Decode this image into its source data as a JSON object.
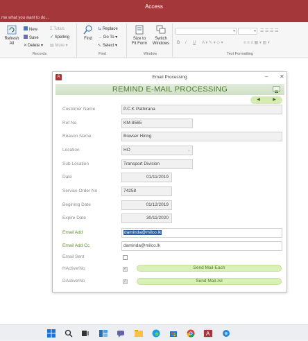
{
  "app": {
    "title": "Access",
    "tell_me": "me what you want to do..."
  },
  "ribbon": {
    "records": {
      "label": "Records",
      "refresh": "Refresh\nAll",
      "new": "New",
      "save": "Save",
      "delete": "Delete",
      "totals": "Totals",
      "spelling": "Spelling",
      "more": "More"
    },
    "find": {
      "label": "Find",
      "find": "Find",
      "replace": "Replace",
      "goto": "Go To",
      "select": "Select"
    },
    "window": {
      "label": "Window",
      "size_to_fit": "Size to\nFit Form",
      "switch_windows": "Switch\nWindows"
    },
    "text_formatting": {
      "label": "Text Formatting",
      "bold": "B",
      "italic": "I",
      "underline": "U"
    }
  },
  "dialog": {
    "window_title": "Email Processing",
    "heading": "REMIND E-MAIL PROCESSING",
    "nav_prev": "◀",
    "nav_next": "▶",
    "fields": {
      "customer_name": {
        "label": "Customer Name",
        "value": "P.C.K Pathirana"
      },
      "ref_no": {
        "label": "Ref No",
        "value": "KM-8565"
      },
      "reason_name": {
        "label": "Reason Name",
        "value": "Bowser Hiring"
      },
      "location": {
        "label": "Location",
        "value": "HO"
      },
      "sub_location": {
        "label": "Sub Location",
        "value": "Transport Division"
      },
      "date": {
        "label": "Date",
        "value": "01/11/2019"
      },
      "service_order_no": {
        "label": "Service Order No",
        "value": "74258"
      },
      "begining_date": {
        "label": "Begining Date",
        "value": "01/12/2019"
      },
      "expire_date": {
        "label": "Expire Date",
        "value": "30/11/2020"
      },
      "email_add": {
        "label": "Email Add",
        "value": "daminda@milco.lk"
      },
      "email_add_cc": {
        "label": "Email Add Cc",
        "value": "daminda@milco.lk"
      },
      "email_sent": {
        "label": "Email Sent",
        "checked": false
      },
      "hactive_no": {
        "label": "HActive/No",
        "checked": true
      },
      "dactive_no": {
        "label": "DActive/No",
        "checked": true
      }
    },
    "buttons": {
      "send_each": "Send Mail-Each",
      "send_all": "Send Mail-All"
    }
  },
  "taskbar": {
    "icons": [
      "windows-start-icon",
      "search-icon",
      "task-view-icon",
      "widgets-icon",
      "teams-chat-icon",
      "file-explorer-icon",
      "edge-icon",
      "store-icon",
      "chrome-icon",
      "access-icon",
      "app-icon"
    ]
  },
  "colors": {
    "title_bar": "#a4373a",
    "banner_text": "#4c7a2b",
    "button_fill": "#d9f0b9"
  }
}
